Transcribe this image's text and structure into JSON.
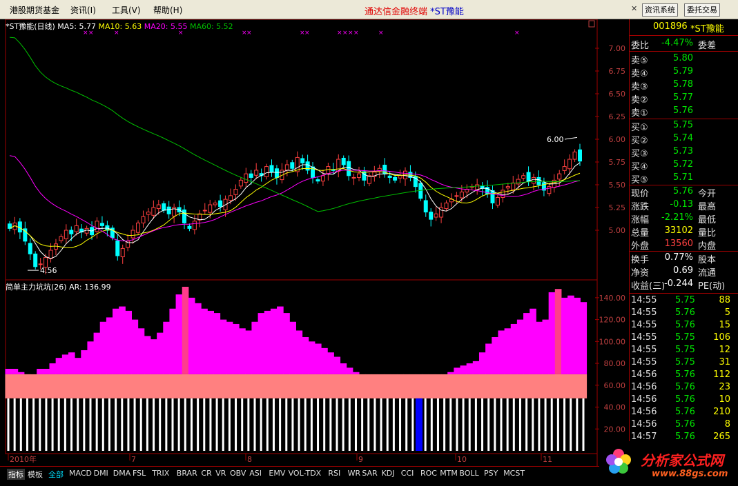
{
  "menu": {
    "items": [
      "港股期货基金",
      "资讯(I)",
      "工具(V)",
      "帮助(H)"
    ],
    "app_title": "通达信金融终端",
    "stock_title": "*ST豫能",
    "right_buttons": [
      "资讯系统",
      "委托交易"
    ]
  },
  "chart": {
    "ma_legend": {
      "name": "*ST豫能(日线)",
      "ma5": "MA5: 5.77",
      "ma10": "MA10: 5.63",
      "ma20": "MA20: 5.55",
      "ma60": "MA60: 5.52"
    },
    "high_label": "6.00",
    "low_label": "4.56",
    "price_ticks": [
      "7.00",
      "6.75",
      "6.50",
      "6.25",
      "6.00",
      "5.75",
      "5.50",
      "5.25",
      "5.00"
    ],
    "indicator_legend": "简单主力坑坑(26)  AR: 136.99",
    "indicator_ticks": [
      "140.00",
      "120.00",
      "100.00",
      "80.00",
      "60.00",
      "40.00",
      "20.00"
    ],
    "months": [
      "2010年",
      "7",
      "8",
      "9",
      "10",
      "11"
    ],
    "colors": {
      "up": "#FF4040",
      "down": "#00FFFF",
      "ma5": "#FFFFFF",
      "ma10": "#FFFF00",
      "ma20": "#FF00FF",
      "ma60": "#00C000",
      "indicator_magenta": "#FF00FF",
      "indicator_salmon": "#FF8080"
    }
  },
  "chart_data": {
    "type": "candlestick",
    "price_axis": {
      "min": 4.5,
      "max": 7.0
    },
    "closes": [
      5.02,
      5.08,
      4.98,
      4.88,
      4.74,
      4.6,
      4.63,
      4.7,
      4.78,
      4.85,
      4.93,
      5.0,
      4.96,
      5.05,
      4.98,
      5.02,
      4.95,
      5.1,
      5.05,
      5.0,
      4.92,
      4.72,
      4.8,
      4.88,
      5.0,
      5.08,
      5.15,
      5.2,
      5.25,
      5.28,
      5.22,
      5.18,
      5.25,
      5.2,
      5.08,
      5.02,
      5.1,
      5.18,
      5.22,
      5.28,
      5.3,
      5.26,
      5.34,
      5.38,
      5.45,
      5.55,
      5.62,
      5.58,
      5.66,
      5.6,
      5.7,
      5.64,
      5.58,
      5.66,
      5.72,
      5.68,
      5.8,
      5.74,
      5.66,
      5.58,
      5.54,
      5.6,
      5.7,
      5.66,
      5.78,
      5.72,
      5.6,
      5.58,
      5.62,
      5.55,
      5.6,
      5.64,
      5.68,
      5.62,
      5.58,
      5.55,
      5.6,
      5.65,
      5.58,
      5.48,
      5.35,
      5.2,
      5.12,
      5.18,
      5.25,
      5.3,
      5.34,
      5.38,
      5.42,
      5.45,
      5.48,
      5.5,
      5.46,
      5.4,
      5.3,
      5.36,
      5.44,
      5.48,
      5.52,
      5.56,
      5.6,
      5.54,
      5.58,
      5.5,
      5.44,
      5.48,
      5.55,
      5.62,
      5.7,
      5.78,
      5.86,
      5.76
    ],
    "ma_final": {
      "MA5": 5.77,
      "MA10": 5.63,
      "MA20": 5.55,
      "MA60": 5.52
    },
    "high": 6.0,
    "low": 4.56,
    "indicator": {
      "name": "简单主力坑坑(26)",
      "AR": 136.99,
      "axis": {
        "min": 0,
        "max": 150
      },
      "values": [
        75,
        75,
        72,
        70,
        68,
        75,
        75,
        80,
        85,
        88,
        90,
        85,
        92,
        100,
        108,
        118,
        122,
        130,
        132,
        128,
        120,
        112,
        105,
        102,
        108,
        118,
        130,
        143,
        150,
        140,
        135,
        130,
        128,
        126,
        120,
        118,
        116,
        112,
        110,
        118,
        126,
        128,
        130,
        132,
        126,
        118,
        110,
        104,
        100,
        98,
        94,
        90,
        86,
        80,
        76,
        72,
        66,
        64,
        62,
        60,
        58,
        56,
        54,
        52,
        50,
        48,
        52,
        56,
        60,
        66,
        72,
        76,
        78,
        80,
        82,
        90,
        98,
        104,
        110,
        112,
        116,
        120,
        126,
        130,
        118,
        120,
        145,
        148,
        140,
        142,
        140,
        136
      ]
    }
  },
  "quote": {
    "code": "001896",
    "name": "*ST豫能",
    "weibi_label": "委比",
    "weibi_value": "-4.47%",
    "weicha_label": "委差",
    "asks": [
      {
        "label": "卖⑤",
        "price": "5.80"
      },
      {
        "label": "卖④",
        "price": "5.79"
      },
      {
        "label": "卖③",
        "price": "5.78"
      },
      {
        "label": "卖②",
        "price": "5.77"
      },
      {
        "label": "卖①",
        "price": "5.76"
      }
    ],
    "bids": [
      {
        "label": "买①",
        "price": "5.75"
      },
      {
        "label": "买②",
        "price": "5.74"
      },
      {
        "label": "买③",
        "price": "5.73"
      },
      {
        "label": "买④",
        "price": "5.72"
      },
      {
        "label": "买⑤",
        "price": "5.71"
      }
    ],
    "stats": [
      {
        "label": "现价",
        "value": "5.76",
        "label2": "今开"
      },
      {
        "label": "涨跌",
        "value": "-0.13",
        "label2": "最高"
      },
      {
        "label": "涨幅",
        "value": "-2.21%",
        "label2": "最低"
      },
      {
        "label": "总量",
        "value": "33102",
        "label2": "量比"
      },
      {
        "label": "外盘",
        "value": "13560",
        "label2": "内盘"
      }
    ],
    "stats2": [
      {
        "label": "换手",
        "value": "0.77%",
        "label2": "股本"
      },
      {
        "label": "净资",
        "value": "0.69",
        "label2": "流通"
      },
      {
        "label": "收益(三)",
        "value": "-0.244",
        "label2": "PE(动)"
      }
    ],
    "ticks": [
      {
        "time": "14:55",
        "price": "5.75",
        "vol": "88"
      },
      {
        "time": "14:55",
        "price": "5.76",
        "vol": "5"
      },
      {
        "time": "14:55",
        "price": "5.76",
        "vol": "15"
      },
      {
        "time": "14:55",
        "price": "5.75",
        "vol": "106"
      },
      {
        "time": "14:55",
        "price": "5.75",
        "vol": "12"
      },
      {
        "time": "14:55",
        "price": "5.75",
        "vol": "31"
      },
      {
        "time": "14:56",
        "price": "5.76",
        "vol": "112"
      },
      {
        "time": "14:56",
        "price": "5.76",
        "vol": "23"
      },
      {
        "time": "14:56",
        "price": "5.76",
        "vol": "10"
      },
      {
        "time": "14:56",
        "price": "5.76",
        "vol": "210"
      },
      {
        "time": "14:56",
        "price": "5.76",
        "vol": "8"
      },
      {
        "time": "14:57",
        "price": "5.76",
        "vol": "265"
      }
    ]
  },
  "tabs": [
    "指标",
    "模板",
    "全部",
    "MACD",
    "DMI",
    "DMA",
    "FSL",
    "TRIX",
    "BRAR",
    "CR",
    "VR",
    "OBV",
    "ASI",
    "EMV",
    "VOL-TDX",
    "RSI",
    "WR",
    "SAR",
    "KDJ",
    "CCI",
    "ROC",
    "MTM",
    "BOLL",
    "PSY",
    "MCST"
  ],
  "watermark": {
    "name": "分析家公式网",
    "url": "www.88gs.com"
  }
}
